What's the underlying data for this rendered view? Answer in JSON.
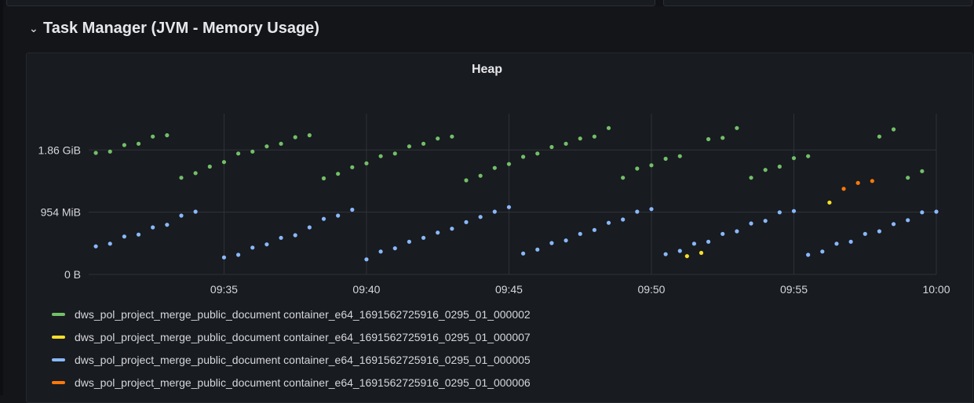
{
  "row": {
    "title": "Task Manager (JVM - Memory Usage)",
    "chevron_icon": "chevron-down-icon"
  },
  "panel": {
    "title": "Heap"
  },
  "colors": {
    "background": "#141519",
    "panel_bg": "#181b1f",
    "grid": "#2f3237",
    "text": "#d5d7dc",
    "green": "#73bf69",
    "yellow": "#fade2a",
    "blue": "#8ab8ff",
    "orange": "#ff780a"
  },
  "chart_data": {
    "type": "scatter",
    "title": "Heap",
    "x_ticks": [
      "09:35",
      "09:40",
      "09:45",
      "09:50",
      "09:55",
      "10:00"
    ],
    "y_ticks": [
      "0 B",
      "954 MiB",
      "1.86 GiB"
    ],
    "y_unit": "MiB",
    "y_range_mib": [
      0,
      2460
    ],
    "x_range": [
      "09:30:15",
      "10:00:00"
    ],
    "grid": true,
    "legend_position": "bottom",
    "series": [
      {
        "name": "dws_pol_project_merge_public_document container_e64_1691562725916_0295_01_000002",
        "color": "#73bf69",
        "points": [
          [
            "09:30:30",
            1860
          ],
          [
            "09:31:00",
            1880
          ],
          [
            "09:31:30",
            1980
          ],
          [
            "09:32:00",
            2000
          ],
          [
            "09:32:30",
            2110
          ],
          [
            "09:33:00",
            2130
          ],
          [
            "09:33:30",
            1480
          ],
          [
            "09:34:00",
            1550
          ],
          [
            "09:34:30",
            1650
          ],
          [
            "09:35:00",
            1720
          ],
          [
            "09:35:30",
            1850
          ],
          [
            "09:36:00",
            1880
          ],
          [
            "09:36:30",
            1960
          ],
          [
            "09:37:00",
            2000
          ],
          [
            "09:37:30",
            2100
          ],
          [
            "09:38:00",
            2130
          ],
          [
            "09:38:30",
            1470
          ],
          [
            "09:39:00",
            1540
          ],
          [
            "09:39:30",
            1640
          ],
          [
            "09:40:00",
            1700
          ],
          [
            "09:40:30",
            1810
          ],
          [
            "09:41:00",
            1850
          ],
          [
            "09:41:30",
            1960
          ],
          [
            "09:42:00",
            2000
          ],
          [
            "09:42:30",
            2080
          ],
          [
            "09:43:00",
            2110
          ],
          [
            "09:43:30",
            1440
          ],
          [
            "09:44:00",
            1510
          ],
          [
            "09:44:30",
            1630
          ],
          [
            "09:45:00",
            1690
          ],
          [
            "09:45:30",
            1800
          ],
          [
            "09:46:00",
            1850
          ],
          [
            "09:46:30",
            1950
          ],
          [
            "09:47:00",
            2000
          ],
          [
            "09:47:30",
            2080
          ],
          [
            "09:48:00",
            2110
          ],
          [
            "09:48:30",
            2240
          ],
          [
            "09:49:00",
            1480
          ],
          [
            "09:49:30",
            1620
          ],
          [
            "09:50:00",
            1670
          ],
          [
            "09:50:30",
            1770
          ],
          [
            "09:51:00",
            1810
          ],
          [
            "09:52:00",
            2070
          ],
          [
            "09:52:30",
            2090
          ],
          [
            "09:53:00",
            2240
          ],
          [
            "09:53:30",
            1480
          ],
          [
            "09:54:00",
            1600
          ],
          [
            "09:54:30",
            1650
          ],
          [
            "09:55:00",
            1780
          ],
          [
            "09:55:30",
            1810
          ],
          [
            "09:58:00",
            2110
          ],
          [
            "09:58:30",
            2220
          ],
          [
            "09:59:00",
            1480
          ],
          [
            "09:59:30",
            1580
          ]
        ]
      },
      {
        "name": "dws_pol_project_merge_public_document container_e64_1691562725916_0295_01_000007",
        "color": "#fade2a",
        "points": [
          [
            "09:51:15",
            280
          ],
          [
            "09:51:45",
            330
          ],
          [
            "09:56:15",
            1100
          ]
        ]
      },
      {
        "name": "dws_pol_project_merge_public_document container_e64_1691562725916_0295_01_000005",
        "color": "#8ab8ff",
        "points": [
          [
            "09:30:30",
            430
          ],
          [
            "09:31:00",
            470
          ],
          [
            "09:31:30",
            580
          ],
          [
            "09:32:00",
            610
          ],
          [
            "09:32:30",
            720
          ],
          [
            "09:33:00",
            760
          ],
          [
            "09:33:30",
            900
          ],
          [
            "09:34:00",
            960
          ],
          [
            "09:35:00",
            260
          ],
          [
            "09:35:30",
            300
          ],
          [
            "09:36:00",
            410
          ],
          [
            "09:36:30",
            460
          ],
          [
            "09:37:00",
            560
          ],
          [
            "09:37:30",
            600
          ],
          [
            "09:38:00",
            720
          ],
          [
            "09:38:30",
            850
          ],
          [
            "09:39:00",
            900
          ],
          [
            "09:39:30",
            990
          ],
          [
            "09:40:00",
            230
          ],
          [
            "09:40:30",
            350
          ],
          [
            "09:41:00",
            400
          ],
          [
            "09:41:30",
            500
          ],
          [
            "09:42:00",
            560
          ],
          [
            "09:42:30",
            640
          ],
          [
            "09:43:00",
            700
          ],
          [
            "09:43:30",
            800
          ],
          [
            "09:44:00",
            880
          ],
          [
            "09:44:30",
            960
          ],
          [
            "09:45:00",
            1030
          ],
          [
            "09:45:30",
            320
          ],
          [
            "09:46:00",
            380
          ],
          [
            "09:46:30",
            480
          ],
          [
            "09:47:00",
            520
          ],
          [
            "09:47:30",
            620
          ],
          [
            "09:48:00",
            680
          ],
          [
            "09:48:30",
            790
          ],
          [
            "09:49:00",
            840
          ],
          [
            "09:49:30",
            960
          ],
          [
            "09:50:00",
            1000
          ],
          [
            "09:50:30",
            310
          ],
          [
            "09:51:00",
            360
          ],
          [
            "09:51:30",
            470
          ],
          [
            "09:52:00",
            500
          ],
          [
            "09:52:30",
            620
          ],
          [
            "09:53:00",
            660
          ],
          [
            "09:53:30",
            780
          ],
          [
            "09:54:00",
            820
          ],
          [
            "09:54:30",
            950
          ],
          [
            "09:55:00",
            970
          ],
          [
            "09:55:30",
            300
          ],
          [
            "09:56:00",
            350
          ],
          [
            "09:56:30",
            470
          ],
          [
            "09:57:00",
            500
          ],
          [
            "09:57:30",
            620
          ],
          [
            "09:58:00",
            660
          ],
          [
            "09:58:30",
            770
          ],
          [
            "09:59:00",
            830
          ],
          [
            "09:59:30",
            950
          ],
          [
            "10:00:00",
            960
          ]
        ]
      },
      {
        "name": "dws_pol_project_merge_public_document container_e64_1691562725916_0295_01_000006",
        "color": "#ff780a",
        "points": [
          [
            "09:56:45",
            1310
          ],
          [
            "09:57:15",
            1400
          ],
          [
            "09:57:45",
            1430
          ]
        ]
      }
    ]
  }
}
